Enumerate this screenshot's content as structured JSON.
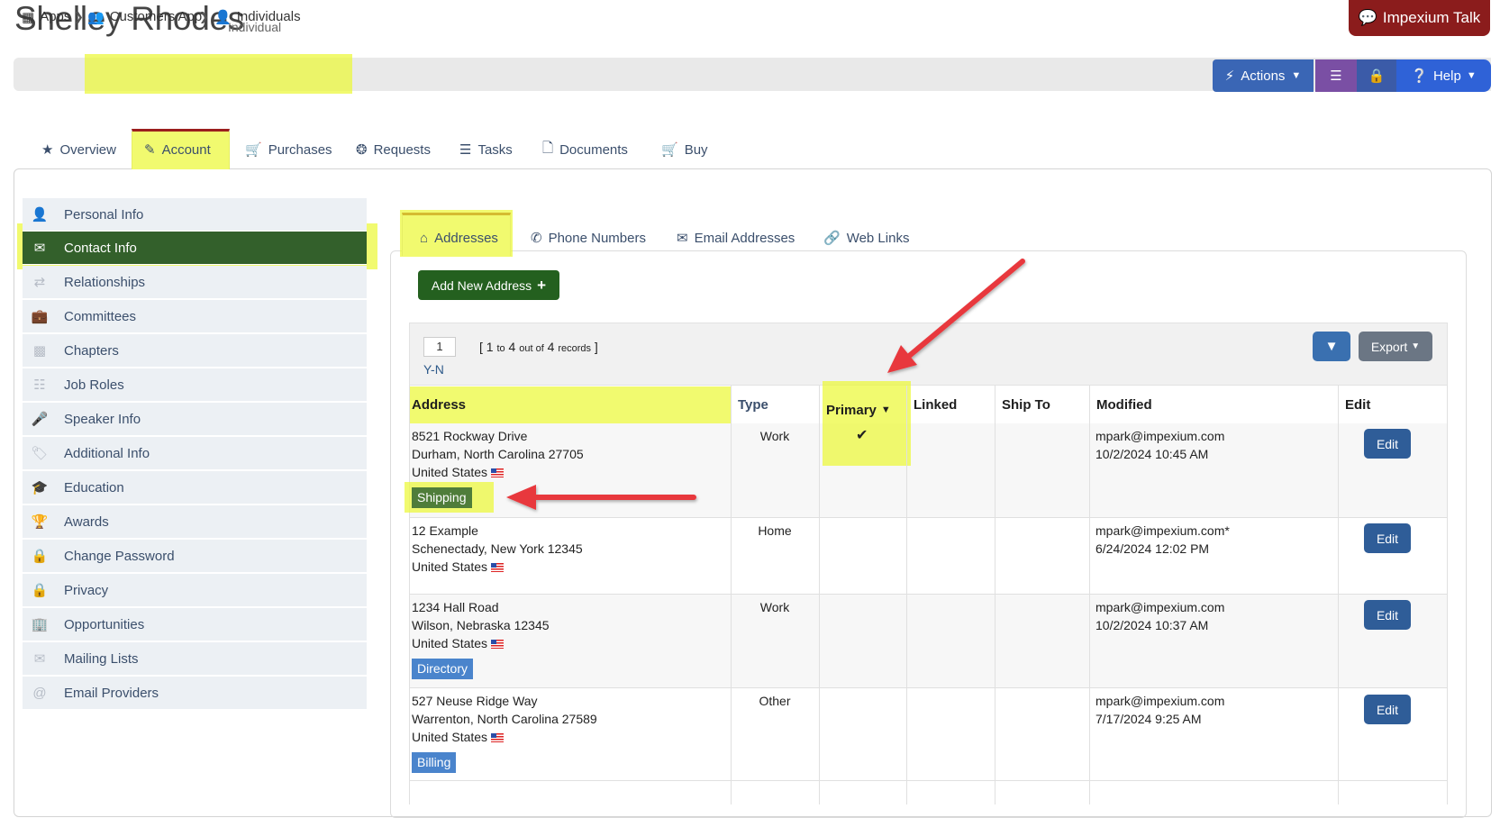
{
  "header": {
    "title": "Shelley Rhodes",
    "subtitle": "Individual",
    "talk_button": "Impexium Talk"
  },
  "breadcrumb": {
    "items": [
      "Apps",
      "Customers App",
      "Individuals"
    ]
  },
  "toolbar": {
    "actions_label": "Actions",
    "help_label": "Help"
  },
  "tabs": [
    "Overview",
    "Account",
    "Purchases",
    "Requests",
    "Tasks",
    "Documents",
    "Buy"
  ],
  "sidebar": {
    "items": [
      "Personal Info",
      "Contact Info",
      "Relationships",
      "Committees",
      "Chapters",
      "Job Roles",
      "Speaker Info",
      "Additional Info",
      "Education",
      "Awards",
      "Change Password",
      "Privacy",
      "Opportunities",
      "Mailing Lists",
      "Email Providers"
    ]
  },
  "subtabs": [
    "Addresses",
    "Phone Numbers",
    "Email Addresses",
    "Web Links"
  ],
  "add_button": "Add New Address",
  "grid": {
    "page": "1",
    "record_start": "1",
    "record_to": "to",
    "record_end": "4",
    "record_outof": "out of",
    "record_total": "4",
    "record_word": "records",
    "yn": "Y-N",
    "export_label": "Export",
    "columns": [
      "Address",
      "Type",
      "Primary",
      "Linked",
      "Ship To",
      "Modified",
      "Edit"
    ],
    "rows": [
      {
        "line1": "8521 Rockway Drive",
        "line2": "Durham, North Carolina 27705",
        "line3": "United States",
        "tag": "Shipping",
        "type": "Work",
        "primary": "✔",
        "modified_by": "mpark@impexium.com",
        "modified_at": "10/2/2024 10:45 AM",
        "edit": "Edit"
      },
      {
        "line1": "12 Example",
        "line2": "Schenectady, New York 12345",
        "line3": "United States",
        "tag": "",
        "type": "Home",
        "primary": "",
        "modified_by": "mpark@impexium.com*",
        "modified_at": "6/24/2024 12:02 PM",
        "edit": "Edit"
      },
      {
        "line1": "1234 Hall Road",
        "line2": "Wilson, Nebraska 12345",
        "line3": "United States",
        "tag": "Directory",
        "type": "Work",
        "primary": "",
        "modified_by": "mpark@impexium.com",
        "modified_at": "10/2/2024 10:37 AM",
        "edit": "Edit"
      },
      {
        "line1": "527 Neuse Ridge Way",
        "line2": "Warrenton, North Carolina 27589",
        "line3": "United States",
        "tag": "Billing",
        "type": "Other",
        "primary": "",
        "modified_by": "mpark@impexium.com",
        "modified_at": "7/17/2024 9:25 AM",
        "edit": "Edit"
      }
    ]
  },
  "colors": {
    "highlight": "#ecf837",
    "active_green": "#33602b",
    "arrow_red": "#e8383d"
  }
}
